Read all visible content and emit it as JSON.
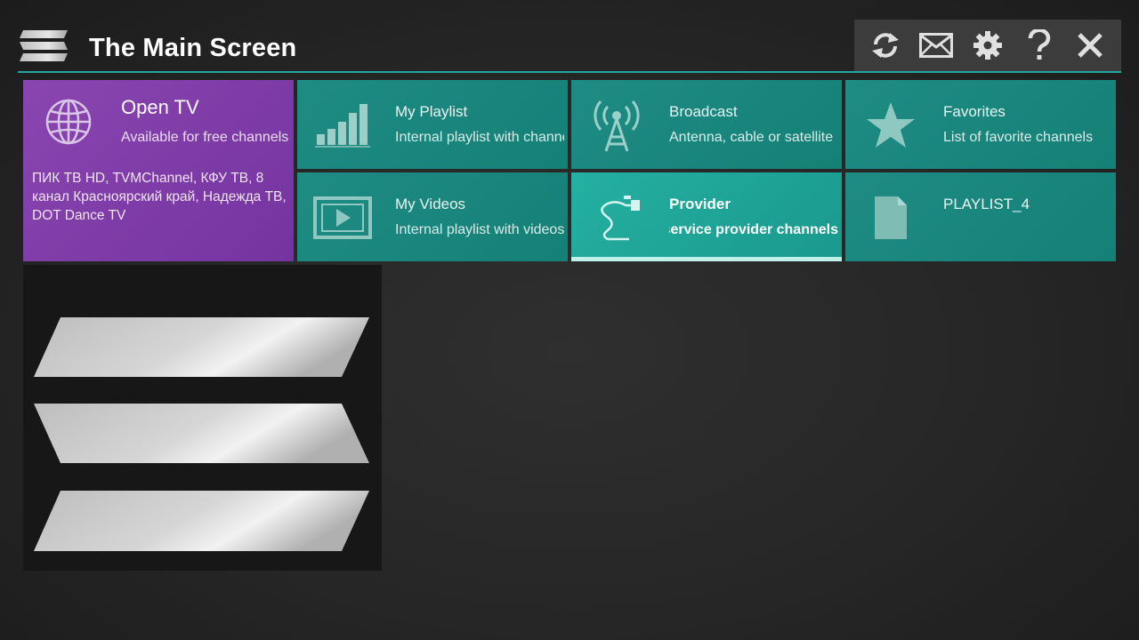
{
  "header": {
    "title": "The Main Screen",
    "logo_icon": "hamburger-menu-icon",
    "toolbar": [
      {
        "name": "refresh-icon",
        "label": "Refresh"
      },
      {
        "name": "mail-icon",
        "label": "Messages"
      },
      {
        "name": "gear-icon",
        "label": "Settings"
      },
      {
        "name": "help-icon",
        "label": "Help"
      },
      {
        "name": "close-icon",
        "label": "Close"
      }
    ]
  },
  "tiles": {
    "open_tv": {
      "title": "Open TV",
      "subtitle": "Available for free channels",
      "channels": "ПИК ТВ HD, TVMChannel, КФУ ТВ, 8 канал Красноярский край, Надежда ТВ, DOT Dance TV",
      "icon": "globe-icon"
    },
    "my_playlist": {
      "title": "My Playlist",
      "subtitle": "Internal playlist with channels",
      "icon": "signal-bars-icon"
    },
    "broadcast": {
      "title": "Broadcast",
      "subtitle": "Antenna, cable or satellite",
      "icon": "antenna-icon"
    },
    "favorites": {
      "title": "Favorites",
      "subtitle": "List of favorite channels",
      "icon": "star-icon"
    },
    "my_videos": {
      "title": "My Videos",
      "subtitle": "Internal playlist with videos",
      "icon": "video-play-icon"
    },
    "provider": {
      "title": "Provider",
      "subtitle": "Your service provider channels",
      "icon": "cable-icon",
      "selected": true
    },
    "playlist_4": {
      "title": "PLAYLIST_4",
      "subtitle": "",
      "icon": "document-icon"
    }
  },
  "colors": {
    "teal": "#148076",
    "teal_active": "#1a998d",
    "purple": "#7434a0",
    "accent_line": "#20a8a0",
    "toolbar_bg": "#3c3c3c"
  },
  "menu_panel": {
    "icon": "hamburger-menu-icon"
  }
}
